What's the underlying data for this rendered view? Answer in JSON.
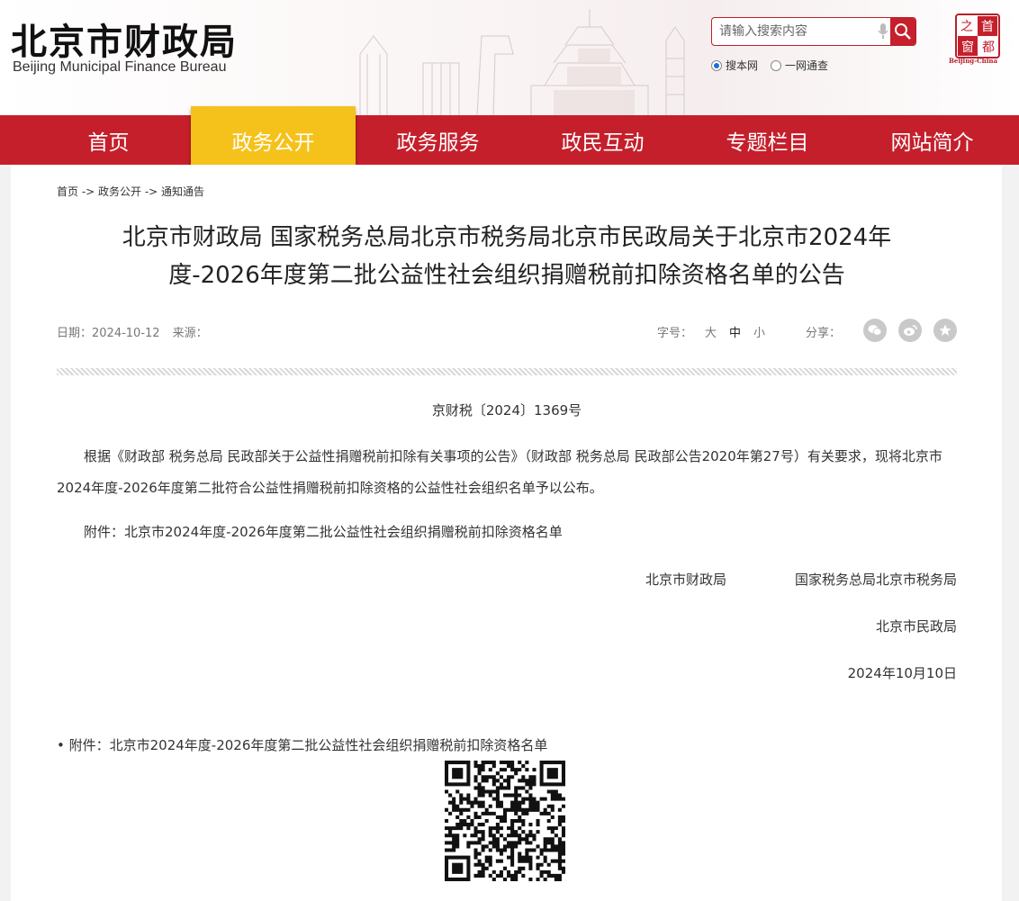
{
  "header": {
    "logo_cn": "北京市财政局",
    "logo_en": "Beijing Municipal Finance Bureau",
    "search_placeholder": "请输入搜索内容",
    "radio_site": "搜本网",
    "radio_all": "一网通查",
    "seal_chars": [
      "首",
      "都",
      "之",
      "窗"
    ],
    "seal_caption": "Beijing-China"
  },
  "nav": {
    "items": [
      "首页",
      "政务公开",
      "政务服务",
      "政民互动",
      "专题栏目",
      "网站简介"
    ],
    "active_index": 1
  },
  "breadcrumb": "首页 -> 政务公开 -> 通知通告",
  "article": {
    "title_line1": "北京市财政局 国家税务总局北京市税务局北京市民政局关于北京市2024年",
    "title_line2": "度-2026年度第二批公益性社会组织捐赠税前扣除资格名单的公告",
    "date_label": "日期：2024-10-12",
    "source_label": "来源：",
    "fontsize_label": "字号：",
    "fontsize_options": [
      "大",
      "中",
      "小"
    ],
    "share_label": "分享：",
    "doc_number": "京财税〔2024〕1369号",
    "body": "根据《财政部 税务总局 民政部关于公益性捐赠税前扣除有关事项的公告》（财政部 税务总局 民政部公告2020年第27号）有关要求，现将北京市2024年度-2026年度第二批符合公益性捐赠税前扣除资格的公益性社会组织名单予以公布。",
    "attachment_line": "附件：北京市2024年度-2026年度第二批公益性社会组织捐赠税前扣除资格名单",
    "signer1": "北京市财政局",
    "signer2": "国家税务总局北京市税务局",
    "signer3": "北京市民政局",
    "sign_date": "2024年10月10日",
    "attachment_link": "• 附件：北京市2024年度-2026年度第二批公益性社会组织捐赠税前扣除资格名单"
  },
  "colors": {
    "brand_red": "#c51f2c",
    "active_gold": "#f5c21b"
  },
  "icons": [
    "mic-icon",
    "search-icon",
    "wechat-icon",
    "weibo-icon",
    "favorite-icon",
    "qr-code"
  ]
}
